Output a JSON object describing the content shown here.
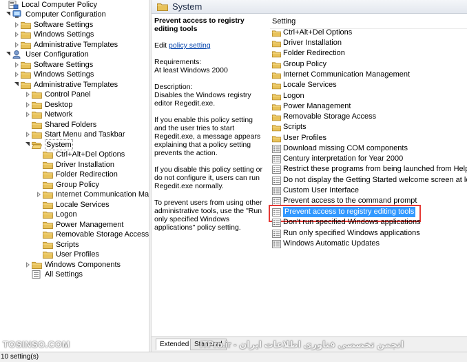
{
  "tree": [
    {
      "label": "Local Computer Policy",
      "icon": "policy-computer-icon"
    },
    {
      "label": "Computer Configuration",
      "icon": "computer-config-icon"
    },
    {
      "label": "Software Settings",
      "icon": "folder-icon"
    },
    {
      "label": "Windows Settings",
      "icon": "folder-icon"
    },
    {
      "label": "Administrative Templates",
      "icon": "folder-icon"
    },
    {
      "label": "User Configuration",
      "icon": "user-config-icon"
    },
    {
      "label": "Software Settings",
      "icon": "folder-icon"
    },
    {
      "label": "Windows Settings",
      "icon": "folder-icon"
    },
    {
      "label": "Administrative Templates",
      "icon": "folder-icon"
    },
    {
      "label": "Control Panel",
      "icon": "folder-icon"
    },
    {
      "label": "Desktop",
      "icon": "folder-icon"
    },
    {
      "label": "Network",
      "icon": "folder-icon"
    },
    {
      "label": "Shared Folders",
      "icon": "folder-icon"
    },
    {
      "label": "Start Menu and Taskbar",
      "icon": "folder-icon"
    },
    {
      "label": "System",
      "icon": "folder-open-icon"
    },
    {
      "label": "Ctrl+Alt+Del Options",
      "icon": "folder-icon"
    },
    {
      "label": "Driver Installation",
      "icon": "folder-icon"
    },
    {
      "label": "Folder Redirection",
      "icon": "folder-icon"
    },
    {
      "label": "Group Policy",
      "icon": "folder-icon"
    },
    {
      "label": "Internet Communication Manag",
      "icon": "folder-icon"
    },
    {
      "label": "Locale Services",
      "icon": "folder-icon"
    },
    {
      "label": "Logon",
      "icon": "folder-icon"
    },
    {
      "label": "Power Management",
      "icon": "folder-icon"
    },
    {
      "label": "Removable Storage Access",
      "icon": "folder-icon"
    },
    {
      "label": "Scripts",
      "icon": "folder-icon"
    },
    {
      "label": "User Profiles",
      "icon": "folder-icon"
    },
    {
      "label": "Windows Components",
      "icon": "folder-icon"
    },
    {
      "label": "All Settings",
      "icon": "all-settings-icon"
    }
  ],
  "header": {
    "title": "System"
  },
  "description": {
    "title": "Prevent access to registry editing tools",
    "edit_prefix": "Edit",
    "edit_link": "policy setting",
    "requirements_label": "Requirements:",
    "requirements_value": "At least Windows 2000",
    "description_label": "Description:",
    "description_value": "Disables the Windows registry editor Regedit.exe.",
    "para_enable": "If you enable this policy setting and the user tries to start Regedit.exe, a message appears explaining that a policy setting prevents the action.",
    "para_disable": "If you disable this policy setting or do not configure it, users can run Regedit.exe normally.",
    "para_prevent": "To prevent users from using other administrative tools, use the \"Run only specified Windows applications\" policy setting."
  },
  "list": {
    "column_header": "Setting",
    "items": [
      {
        "label": "Ctrl+Alt+Del Options",
        "icon": "folder-icon"
      },
      {
        "label": "Driver Installation",
        "icon": "folder-icon"
      },
      {
        "label": "Folder Redirection",
        "icon": "folder-icon"
      },
      {
        "label": "Group Policy",
        "icon": "folder-icon"
      },
      {
        "label": "Internet Communication Management",
        "icon": "folder-icon"
      },
      {
        "label": "Locale Services",
        "icon": "folder-icon"
      },
      {
        "label": "Logon",
        "icon": "folder-icon"
      },
      {
        "label": "Power Management",
        "icon": "folder-icon"
      },
      {
        "label": "Removable Storage Access",
        "icon": "folder-icon"
      },
      {
        "label": "Scripts",
        "icon": "folder-icon"
      },
      {
        "label": "User Profiles",
        "icon": "folder-icon"
      },
      {
        "label": "Download missing COM components",
        "icon": "setting-icon"
      },
      {
        "label": "Century interpretation for Year 2000",
        "icon": "setting-icon"
      },
      {
        "label": "Restrict these programs from being launched from Help",
        "icon": "setting-icon"
      },
      {
        "label": "Do not display the Getting Started welcome screen at logon",
        "icon": "setting-icon"
      },
      {
        "label": "Custom User Interface",
        "icon": "setting-icon"
      },
      {
        "label": "Prevent access to the command prompt",
        "icon": "setting-icon"
      },
      {
        "label": "Prevent access to registry editing tools",
        "icon": "setting-icon"
      },
      {
        "label": "Don't run specified Windows applications",
        "icon": "setting-icon"
      },
      {
        "label": "Run only specified Windows applications",
        "icon": "setting-icon"
      },
      {
        "label": "Windows Automatic Updates",
        "icon": "setting-icon"
      }
    ]
  },
  "tabs": {
    "extended": "Extended",
    "standard": "Standard"
  },
  "watermark": {
    "left": "TOSINSO.COM",
    "right": "انجمن تخصصی فناوری اطلاعات ایران - ITPro.ir"
  },
  "status": {
    "text": "10 setting(s)"
  },
  "colors": {
    "selection": "#3399ff",
    "highlight_box": "#e53935",
    "link": "#0645ad",
    "folder": "#e8c25a"
  }
}
